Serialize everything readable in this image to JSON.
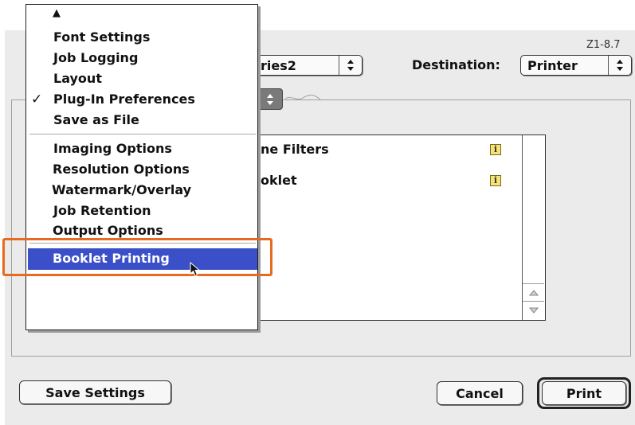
{
  "version_label": "Z1-8.7",
  "printer_popup": {
    "value": "ries2"
  },
  "destination": {
    "label": "Destination:",
    "value": "Printer"
  },
  "plugin_list": {
    "items": [
      {
        "label": "ne Filters",
        "icon": "info-icon"
      },
      {
        "label": "oklet",
        "icon": "info-icon"
      }
    ]
  },
  "menu": {
    "scroll_indicator": "▲",
    "group1": [
      {
        "label": "Font Settings",
        "checked": false
      },
      {
        "label": "Job Logging",
        "checked": false
      },
      {
        "label": "Layout",
        "checked": false
      },
      {
        "label": "Plug-In Preferences",
        "checked": true
      },
      {
        "label": "Save as File",
        "checked": false
      }
    ],
    "group2": [
      {
        "label": "Imaging Options"
      },
      {
        "label": "Resolution Options"
      },
      {
        "label": "Watermark/Overlay"
      },
      {
        "label": "Job Retention"
      },
      {
        "label": "Output Options"
      }
    ],
    "selected": {
      "label": "Booklet Printing"
    },
    "checkmark": "✓"
  },
  "buttons": {
    "save_settings": "Save Settings",
    "cancel": "Cancel",
    "print": "Print"
  },
  "colors": {
    "highlight": "#3b4fc9",
    "callout": "#e86a1e"
  }
}
